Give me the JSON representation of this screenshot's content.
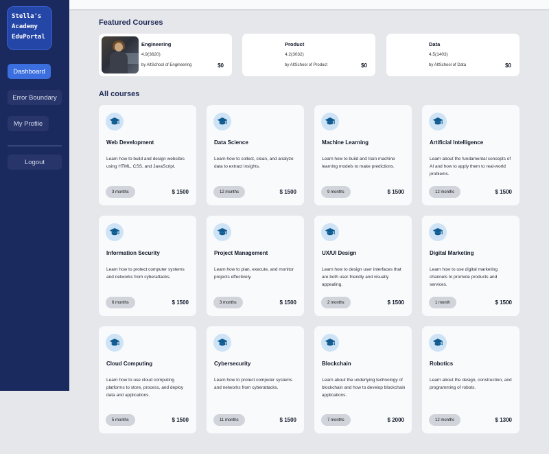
{
  "sidebar": {
    "logo_lines": [
      "Stella's",
      "Academy",
      "EduPortal"
    ],
    "items": [
      {
        "label": "Dashboard"
      },
      {
        "label": "Error Boundary"
      },
      {
        "label": "My Profile"
      }
    ],
    "logout": "Logout"
  },
  "featured": {
    "title": "Featured Courses",
    "items": [
      {
        "name": "Engineering",
        "rating": "4.9(3620)",
        "by": "by AltSchool of Engineering",
        "price": "$0"
      },
      {
        "name": "Product",
        "rating": "4.2(3032)",
        "by": "by AltSchool of Product",
        "price": "$0"
      },
      {
        "name": "Data",
        "rating": "4.5(1403)",
        "by": "by AltSchool of Data",
        "price": "$0"
      }
    ]
  },
  "courses": {
    "title": "All courses",
    "items": [
      {
        "name": "Web Development",
        "desc": "Learn how to build and design websites using HTML, CSS, and JavaScript.",
        "duration": "3 months",
        "price": "$ 1500"
      },
      {
        "name": "Data Science",
        "desc": "Learn how to collect, clean, and analyze data to extract insights.",
        "duration": "12 months",
        "price": "$ 1500"
      },
      {
        "name": "Machine Learning",
        "desc": "Learn how to build and train machine learning models to make predictions.",
        "duration": "9 months",
        "price": "$ 1500"
      },
      {
        "name": "Artificial Intelligence",
        "desc": "Learn about the fundamental concepts of AI and how to apply them to real-world problems.",
        "duration": "12 months",
        "price": "$ 1500"
      },
      {
        "name": "Information Security",
        "desc": "Learn how to protect computer systems and networks from cyberattacks.",
        "duration": "6 months",
        "price": "$ 1500"
      },
      {
        "name": "Project Management",
        "desc": "Learn how to plan, execute, and monitor projects effectively.",
        "duration": "3 months",
        "price": "$ 1500"
      },
      {
        "name": "UX/UI Design",
        "desc": "Learn how to design user interfaces that are both user-friendly and visually appealing.",
        "duration": "2 months",
        "price": "$ 1500"
      },
      {
        "name": "Digital Marketing",
        "desc": "Learn how to use digital marketing channels to promote products and services.",
        "duration": "1 month",
        "price": "$ 1500"
      },
      {
        "name": "Cloud Computing",
        "desc": "Learn how to use cloud computing platforms to store, process, and deploy data and applications.",
        "duration": "5 months",
        "price": "$ 1500"
      },
      {
        "name": "Cybersecurity",
        "desc": "Learn how to protect computer systems and networks from cyberattacks.",
        "duration": "11 months",
        "price": "$ 1500"
      },
      {
        "name": "Blockchain",
        "desc": "Learn about the underlying technology of blockchain and how to develop blockchain applications.",
        "duration": "7 months",
        "price": "$ 2000"
      },
      {
        "name": "Robotics",
        "desc": "Learn about the design, construction, and programming of robots.",
        "duration": "12 months",
        "price": "$ 1300"
      }
    ]
  },
  "icons": {
    "course_icon": "graduation-cap-icon",
    "featured_image": "student-photo"
  },
  "colors": {
    "sidebar": "#1b2a5e",
    "accent": "#3b6fe0",
    "icon": "#0f5a8f",
    "icon_bg": "#cfe3f6"
  }
}
